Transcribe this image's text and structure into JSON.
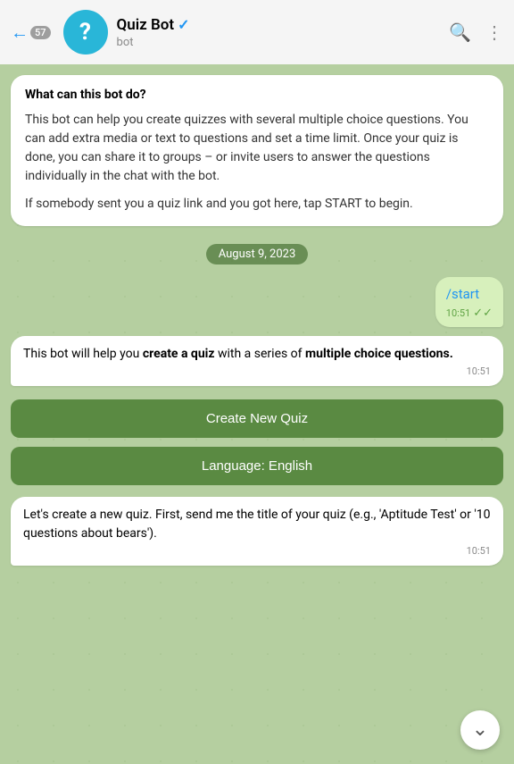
{
  "header": {
    "back_badge": "57",
    "bot_name": "Quiz Bot",
    "bot_status": "bot",
    "verified": true,
    "actions": [
      "search",
      "more"
    ]
  },
  "info_bubble": {
    "title": "What can this bot do?",
    "paragraphs": [
      "This bot can help you create quizzes with several multiple choice questions. You can add extra media or text to questions and set a time limit. Once your quiz is done, you can share it to groups – or invite users to answer the questions individually in the chat with the bot.",
      "If somebody sent you a quiz link and you got here, tap START to begin."
    ]
  },
  "date_separator": "August 9, 2023",
  "messages": [
    {
      "id": "start-command",
      "type": "sent",
      "text": "/start",
      "time": "10:51",
      "read": true,
      "double_check": true
    },
    {
      "id": "bot-reply-1",
      "type": "received",
      "text_parts": [
        {
          "text": "This bot will help you ",
          "bold": false
        },
        {
          "text": "create a quiz",
          "bold": true
        },
        {
          "text": " with a series of ",
          "bold": false
        },
        {
          "text": "multiple choice questions.",
          "bold": true
        }
      ],
      "time": "10:51"
    },
    {
      "id": "create-quiz-btn",
      "type": "button",
      "label": "Create New Quiz"
    },
    {
      "id": "language-btn",
      "type": "button",
      "label": "Language: English"
    },
    {
      "id": "bot-reply-2",
      "type": "received",
      "plain_text": "Let's create a new quiz. First, send me the title of your quiz (e.g., 'Aptitude Test' or '10 questions about bears').",
      "time": "10:51"
    }
  ],
  "scroll_down": {
    "icon": "∨"
  }
}
